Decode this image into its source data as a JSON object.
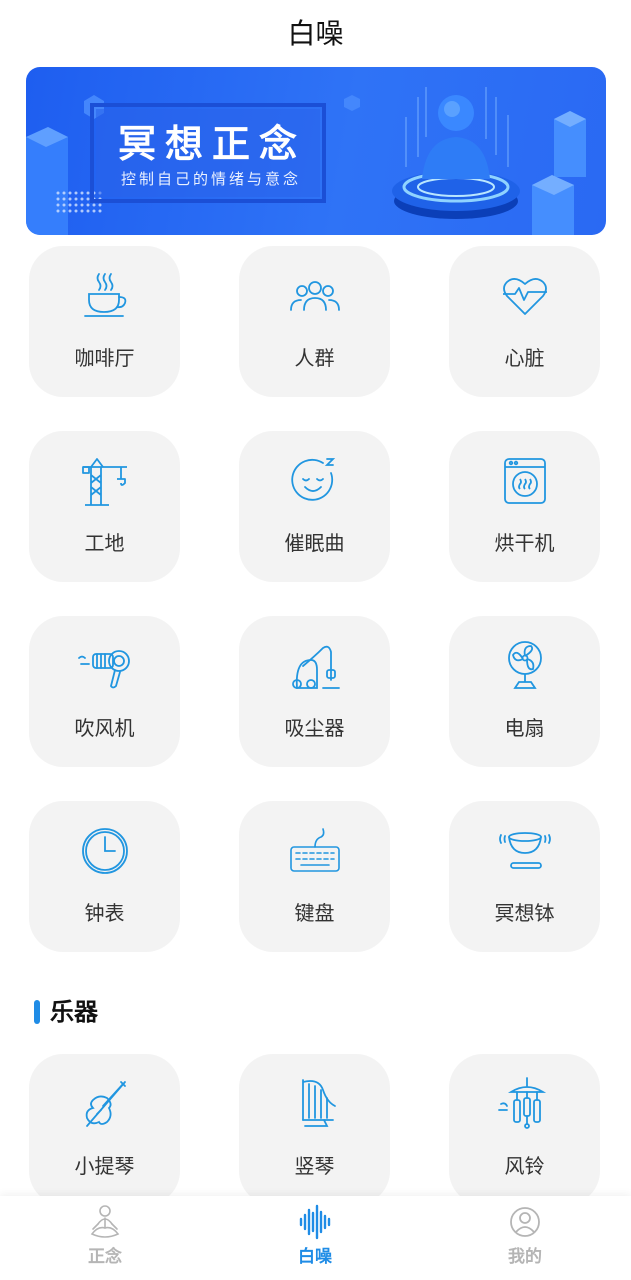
{
  "header": {
    "title": "白噪"
  },
  "banner": {
    "title": "冥想正念",
    "subtitle": "控制自己的情绪与意念"
  },
  "grid": {
    "items": [
      {
        "label": "咖啡厅",
        "icon": "coffee-icon"
      },
      {
        "label": "人群",
        "icon": "crowd-icon"
      },
      {
        "label": "心脏",
        "icon": "heart-icon"
      },
      {
        "label": "工地",
        "icon": "crane-icon"
      },
      {
        "label": "催眠曲",
        "icon": "sleepy-face-icon"
      },
      {
        "label": "烘干机",
        "icon": "dryer-icon"
      },
      {
        "label": "吹风机",
        "icon": "hairdryer-icon"
      },
      {
        "label": "吸尘器",
        "icon": "vacuum-icon"
      },
      {
        "label": "电扇",
        "icon": "fan-icon"
      },
      {
        "label": "钟表",
        "icon": "clock-icon"
      },
      {
        "label": "键盘",
        "icon": "keyboard-icon"
      },
      {
        "label": "冥想钵",
        "icon": "singing-bowl-icon"
      }
    ]
  },
  "instruments": {
    "section_title": "乐器",
    "items": [
      {
        "label": "小提琴",
        "icon": "violin-icon"
      },
      {
        "label": "竖琴",
        "icon": "harp-icon"
      },
      {
        "label": "风铃",
        "icon": "wind-chime-icon"
      }
    ]
  },
  "bottom_nav": {
    "items": [
      {
        "label": "正念",
        "icon": "meditation-icon",
        "active": false
      },
      {
        "label": "白噪",
        "icon": "soundwave-icon",
        "active": true
      },
      {
        "label": "我的",
        "icon": "profile-icon",
        "active": false
      }
    ]
  },
  "colors": {
    "accent": "#1f8ce6",
    "icon_blue": "#2196e0",
    "card_bg": "#f3f3f3",
    "banner": "#2f73f6"
  }
}
